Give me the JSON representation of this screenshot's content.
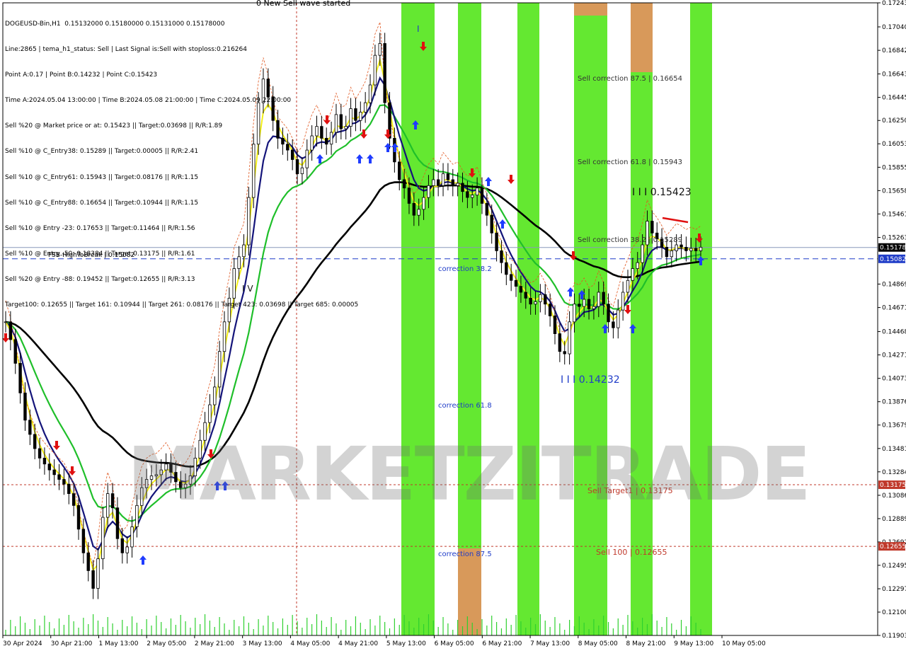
{
  "chart_data": {
    "type": "candlestick",
    "symbol_line": "DOGEUSD-Bin,H1  0.15132000 0.15180000 0.15131000 0.15178000",
    "title_note": "0 New Sell wave started",
    "info_lines": [
      "Line:2865 | tema_h1_status: Sell | Last Signal is:Sell with stoploss:0.216264",
      "Point A:0.17 | Point B:0.14232 | Point C:0.15423",
      "Time A:2024.05.04 13:00:00 | Time B:2024.05.08 21:00:00 | Time C:2024.05.09 22:00:00",
      "Sell %20 @ Market price or at: 0.15423 || Target:0.03698 || R/R:1.89",
      "Sell %10 @ C_Entry38: 0.15289 || Target:0.00005 || R/R:2.41",
      "Sell %10 @ C_Entry61: 0.15943 || Target:0.08176 || R/R:1.15",
      "Sell %10 @ C_Entry88: 0.16654 || Target:0.10944 || R/R:1.15",
      "Sell %10 @ Entry -23: 0.17653 || Target:0.11464 || R/R:1.56",
      "Sell %10 @ Entry -50: 0.18384 || Target:0.13175 || R/R:1.61",
      "Sell %20 @ Entry -88: 0.19452 || Target:0.12655 || R/R:3.13",
      "Target100: 0.12655 || Target 161: 0.10944 || Target 261: 0.08176 || Target 423: 0.03698 || Target 685: 0.00005"
    ],
    "y_ticks": [
      "0.17243",
      "0.17040",
      "0.16842",
      "0.16643",
      "0.16445",
      "0.16250",
      "0.16053",
      "0.15855",
      "0.15658",
      "0.15461",
      "0.15263",
      "0.14869",
      "0.14671",
      "0.14468",
      "0.14271",
      "0.14073",
      "0.13876",
      "0.13679",
      "0.13481",
      "0.13284",
      "0.13086",
      "0.12889",
      "0.12692",
      "0.12495",
      "0.12297",
      "0.12100",
      "0.11903"
    ],
    "y_range": [
      0.11903,
      0.17243
    ],
    "x_ticks": [
      "30 Apr 2024",
      "30 Apr 21:00",
      "1 May 13:00",
      "2 May 05:00",
      "2 May 21:00",
      "3 May 13:00",
      "4 May 05:00",
      "4 May 21:00",
      "5 May 13:00",
      "6 May 05:00",
      "6 May 21:00",
      "7 May 13:00",
      "8 May 05:00",
      "8 May 21:00",
      "9 May 13:00",
      "10 May 05:00"
    ],
    "price_tags": [
      {
        "label": "0.15178",
        "value": 0.15178,
        "bg": "#000000",
        "fg": "#ffffff"
      },
      {
        "label": "0.15082",
        "value": 0.15082,
        "bg": "#1f3cc8",
        "fg": "#ffffff"
      },
      {
        "label": "0.13175",
        "value": 0.13175,
        "bg": "#c0392b",
        "fg": "#ffffff"
      },
      {
        "label": "0.12655",
        "value": 0.12655,
        "bg": "#c0392b",
        "fg": "#ffffff"
      }
    ],
    "levels": [
      {
        "label": "FSB-HighToBreak | 0.15082",
        "value": 0.15082,
        "color": "#1f3cc8"
      },
      {
        "label": "Sell Target1 | 0.13175",
        "value": 0.13175,
        "color": "#c0392b"
      },
      {
        "label": "Sell 100 | 0.12655",
        "value": 0.12655,
        "color": "#c0392b"
      }
    ],
    "annotations": [
      {
        "text": "Sell correction 87.5 | 0.16654",
        "color": "#333333"
      },
      {
        "text": "Sell correction 61.8 | 0.15943",
        "color": "#333333"
      },
      {
        "text": "Sell correction 38.2 | 0.15289",
        "color": "#333333"
      },
      {
        "text": "I I I 0.15423",
        "color": "#111111"
      },
      {
        "text": "I I I 0.14232",
        "color": "#1f3cc8"
      },
      {
        "text": "correction 38.2",
        "color": "#1f3cc8"
      },
      {
        "text": "correction 61.8",
        "color": "#1f3cc8"
      },
      {
        "text": "correction 87.5",
        "color": "#1f3cc8"
      },
      {
        "text": "I V",
        "color": "#111111"
      },
      {
        "text": "I",
        "color": "#1f3cc8"
      }
    ],
    "watermark": "MARKETZITRADE",
    "close_series": [
      0.1455,
      0.144,
      0.142,
      0.1395,
      0.1372,
      0.136,
      0.1348,
      0.134,
      0.1335,
      0.133,
      0.1326,
      0.1322,
      0.1318,
      0.131,
      0.13,
      0.128,
      0.126,
      0.1245,
      0.123,
      0.1255,
      0.129,
      0.131,
      0.1298,
      0.1272,
      0.126,
      0.1265,
      0.1282,
      0.13,
      0.1315,
      0.1322,
      0.1325,
      0.1326,
      0.133,
      0.1335,
      0.1328,
      0.132,
      0.1315,
      0.1318,
      0.1325,
      0.134,
      0.1355,
      0.137,
      0.1385,
      0.14,
      0.143,
      0.1455,
      0.1475,
      0.15,
      0.151,
      0.152,
      0.156,
      0.1605,
      0.164,
      0.166,
      0.1645,
      0.1625,
      0.161,
      0.1605,
      0.16,
      0.1592,
      0.158,
      0.1585,
      0.16,
      0.1612,
      0.162,
      0.161,
      0.1605,
      0.1615,
      0.163,
      0.1618,
      0.162,
      0.1635,
      0.1625,
      0.1632,
      0.164,
      0.1655,
      0.168,
      0.169,
      0.164,
      0.161,
      0.159,
      0.1575,
      0.1568,
      0.1555,
      0.1545,
      0.155,
      0.156,
      0.157,
      0.1575,
      0.157,
      0.158,
      0.1575,
      0.157,
      0.1572,
      0.1565,
      0.156,
      0.1562,
      0.1568,
      0.1555,
      0.1545,
      0.153,
      0.1515,
      0.1505,
      0.1495,
      0.149,
      0.1485,
      0.148,
      0.1475,
      0.147,
      0.1472,
      0.1478,
      0.147,
      0.146,
      0.1445,
      0.143,
      0.1428,
      0.1455,
      0.147,
      0.1468,
      0.1474,
      0.1466,
      0.1468,
      0.148,
      0.147,
      0.1455,
      0.145,
      0.1465,
      0.148,
      0.149,
      0.15,
      0.1505,
      0.152,
      0.154,
      0.153,
      0.1525,
      0.1518,
      0.151,
      0.1515,
      0.152,
      0.1518,
      0.1515,
      0.1517,
      0.1515,
      0.1518
    ]
  }
}
